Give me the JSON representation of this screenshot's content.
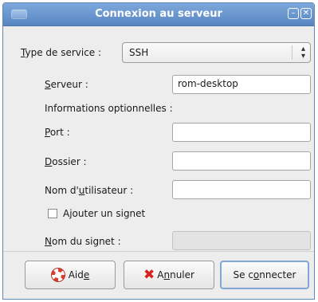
{
  "window": {
    "title": "Connexion au serveur"
  },
  "service": {
    "label": "Type de service :",
    "value": "SSH"
  },
  "server": {
    "label": "Serveur :",
    "value": "rom-desktop"
  },
  "optional": {
    "heading": "Informations optionnelles :"
  },
  "port": {
    "label": "Port :",
    "value": ""
  },
  "folder": {
    "label": "Dossier :",
    "value": ""
  },
  "username": {
    "label": "Nom d'utilisateur :",
    "value": ""
  },
  "bookmark": {
    "checkbox_label": "Ajouter un signet",
    "name_label": "Nom du signet :",
    "checked": false,
    "value": ""
  },
  "buttons": {
    "help": "Aide",
    "cancel": "Annuler",
    "connect": "Se connecter"
  },
  "colors": {
    "titlebar": "#6a96cf",
    "cancel_icon": "#d81e1e",
    "help_icon": "#e23b2e"
  }
}
